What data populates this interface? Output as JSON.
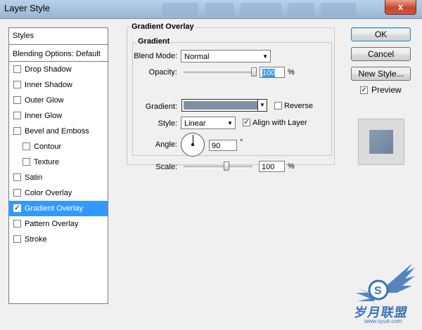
{
  "window": {
    "title": "Layer Style",
    "close_label": "x"
  },
  "styles_panel": {
    "header": "Styles",
    "blending_options": "Blending Options: Default",
    "items": [
      {
        "label": "Drop Shadow",
        "checked": false,
        "sub": false,
        "active": false
      },
      {
        "label": "Inner Shadow",
        "checked": false,
        "sub": false,
        "active": false
      },
      {
        "label": "Outer Glow",
        "checked": false,
        "sub": false,
        "active": false
      },
      {
        "label": "Inner Glow",
        "checked": false,
        "sub": false,
        "active": false
      },
      {
        "label": "Bevel and Emboss",
        "checked": false,
        "sub": false,
        "active": false
      },
      {
        "label": "Contour",
        "checked": false,
        "sub": true,
        "active": false
      },
      {
        "label": "Texture",
        "checked": false,
        "sub": true,
        "active": false
      },
      {
        "label": "Satin",
        "checked": false,
        "sub": false,
        "active": false
      },
      {
        "label": "Color Overlay",
        "checked": false,
        "sub": false,
        "active": false
      },
      {
        "label": "Gradient Overlay",
        "checked": true,
        "sub": false,
        "active": true
      },
      {
        "label": "Pattern Overlay",
        "checked": false,
        "sub": false,
        "active": false
      },
      {
        "label": "Stroke",
        "checked": false,
        "sub": false,
        "active": false
      }
    ]
  },
  "gradient_overlay": {
    "section_title": "Gradient Overlay",
    "sub_title": "Gradient",
    "blend_mode_label": "Blend Mode:",
    "blend_mode_value": "Normal",
    "opacity_label": "Opacity:",
    "opacity_value": "100",
    "opacity_unit": "%",
    "opacity_level": 1.0,
    "gradient_label": "Gradient:",
    "gradient_color": "#7f8fa2",
    "reverse_label": "Reverse",
    "reverse_checked": false,
    "style_label": "Style:",
    "style_value": "Linear",
    "align_label": "Align with Layer",
    "align_checked": true,
    "angle_label": "Angle:",
    "angle_value": "90",
    "angle_unit": "°",
    "scale_label": "Scale:",
    "scale_value": "100",
    "scale_unit": "%",
    "scale_level": 0.62
  },
  "buttons": {
    "ok": "OK",
    "cancel": "Cancel",
    "new_style": "New Style...",
    "preview_label": "Preview",
    "preview_checked": true
  },
  "watermark": {
    "brand": "岁月联盟",
    "url": "www.syue.com"
  }
}
